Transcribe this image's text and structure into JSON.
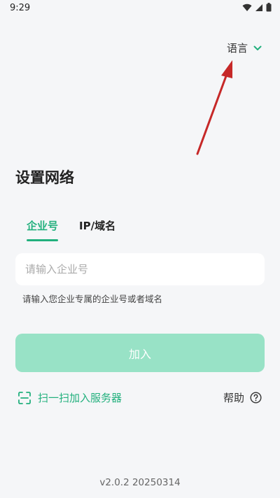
{
  "status_bar": {
    "time": "9:29",
    "icons": [
      "wifi-icon",
      "signal-icon",
      "battery-icon"
    ]
  },
  "header": {
    "language_label": "语言",
    "language_icon": "chevron-down-icon"
  },
  "page": {
    "title": "设置网络"
  },
  "tabs": [
    {
      "label": "企业号",
      "active": true
    },
    {
      "label": "IP/域名",
      "active": false
    }
  ],
  "form": {
    "input_placeholder": "请输入企业号",
    "input_value": "",
    "hint": "请输入您企业专属的企业号或者域名",
    "join_label": "加入"
  },
  "actions": {
    "scan_label": "扫一扫加入服务器",
    "scan_icon": "scan-icon",
    "help_label": "帮助",
    "help_icon": "question-circle-icon"
  },
  "footer": {
    "version": "v2.0.2 20250314"
  },
  "colors": {
    "accent": "#22b07d",
    "button_disabled": "#98e2c6",
    "background": "#f5f6f8",
    "annotation_arrow": "#c62828"
  }
}
